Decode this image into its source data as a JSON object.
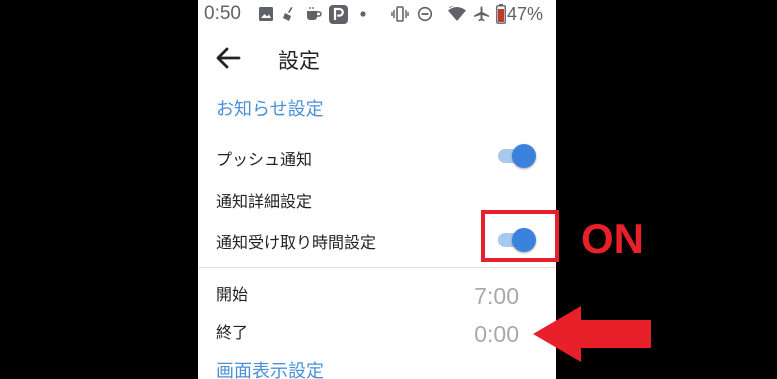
{
  "status_bar": {
    "time": "0:50",
    "battery": "47%",
    "icons": [
      "image-icon",
      "broom-icon",
      "coffee-icon",
      "paypay-icon",
      "dot-icon",
      "vibrate-icon",
      "dnd-icon",
      "wifi-icon",
      "airplane-icon",
      "battery-icon"
    ]
  },
  "app_bar": {
    "back_icon": "arrow-left-icon",
    "title": "設定"
  },
  "notification_section": {
    "header": "お知らせ設定",
    "push": {
      "label": "プッシュ通知",
      "enabled": true
    },
    "detail": {
      "label": "通知詳細設定"
    },
    "time_setting": {
      "label": "通知受け取り時間設定",
      "enabled": true
    },
    "start": {
      "label": "開始",
      "value": "7:00"
    },
    "end": {
      "label": "終了",
      "value": "0:00"
    }
  },
  "display_section": {
    "header": "画面表示設定"
  },
  "annotation": {
    "on_label": "ON",
    "color": "#e8202a"
  },
  "colors": {
    "accent": "#4a90d9",
    "toggle_thumb": "#3b82dd",
    "toggle_track": "#a8c8ee"
  }
}
